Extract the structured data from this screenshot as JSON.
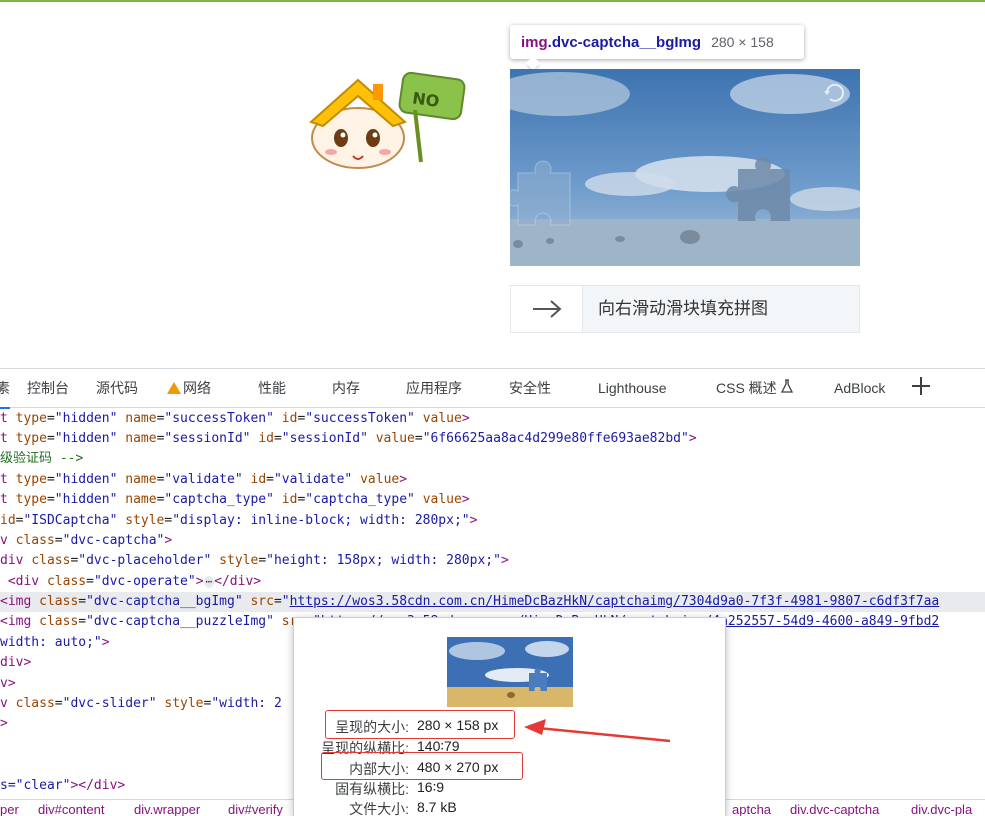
{
  "page": {
    "mascot_sign_text": "NO",
    "tooltip": {
      "tag": "img",
      "class_name": ".dvc-captcha__bgImg",
      "size": "280 × 158"
    },
    "slider_text": "向右滑动滑块填充拼图"
  },
  "devtools": {
    "tabs": [
      {
        "label": "元素",
        "visible_text": "素"
      },
      {
        "label": "控制台"
      },
      {
        "label": "源代码"
      },
      {
        "label": "网络",
        "warning": true
      },
      {
        "label": "性能"
      },
      {
        "label": "内存"
      },
      {
        "label": "应用程序"
      },
      {
        "label": "安全性"
      },
      {
        "label": "Lighthouse"
      },
      {
        "label": "CSS 概述"
      },
      {
        "label": "AdBlock"
      }
    ],
    "code_lines": [
      "t type=\"hidden\" name=\"successToken\" id=\"successToken\" value>",
      "t type=\"hidden\" name=\"sessionId\" id=\"sessionId\" value=\"6f66625aa8ac4d299e80ffe693ae82bd\">",
      "级验证码 -->",
      "t type=\"hidden\" name=\"validate\" id=\"validate\" value>",
      "t type=\"hidden\" name=\"captcha_type\" id=\"captcha_type\" value>",
      "id=\"ISDCaptcha\" style=\"display: inline-block; width: 280px;\">",
      "v class=\"dvc-captcha\">",
      "div class=\"dvc-placeholder\" style=\"height: 158px; width: 280px;\">",
      "<div class=\"dvc-operate\">…</div>",
      "<img class=\"dvc-captcha__bgImg\" src=\"https://wos3.58cdn.com.cn/HimeDcBazHkN/captchaimg/7304d9a0-7f3f-4981-9807-c6df3f7aa",
      "<img class=\"dvc-captcha__puzzleImg\" src=\"https://wos3.58cdn.com.cn/HimeDcBazHkN/captchaimg/4a252557-54d9-4600-a849-9fbd2",
      "width: auto;\">",
      "div>",
      "v>",
      "v class=\"dvc-slider\" style=\"width: 2",
      ">",
      "",
      "",
      "s=\"clear\"></div>"
    ],
    "breadcrumb": [
      "per",
      "div#content",
      "div.wrapper",
      "div#verify",
      "aptcha",
      "div.dvc-captcha",
      "div.dvc-pla"
    ],
    "image_preview": {
      "rows": [
        {
          "key": "呈现的大小:",
          "value": "280 × 158 px"
        },
        {
          "key": "呈现的纵横比:",
          "value": "140∶79"
        },
        {
          "key": "内部大小:",
          "value": "480 × 270 px"
        },
        {
          "key": "固有纵横比:",
          "value": "16∶9"
        },
        {
          "key": "文件大小:",
          "value": "8.7 kB"
        }
      ]
    }
  },
  "colors": {
    "accent": "#1a73e8",
    "highlight": "#e53935",
    "tag": "#881280",
    "attr": "#994500",
    "value": "#1a1aa6"
  }
}
